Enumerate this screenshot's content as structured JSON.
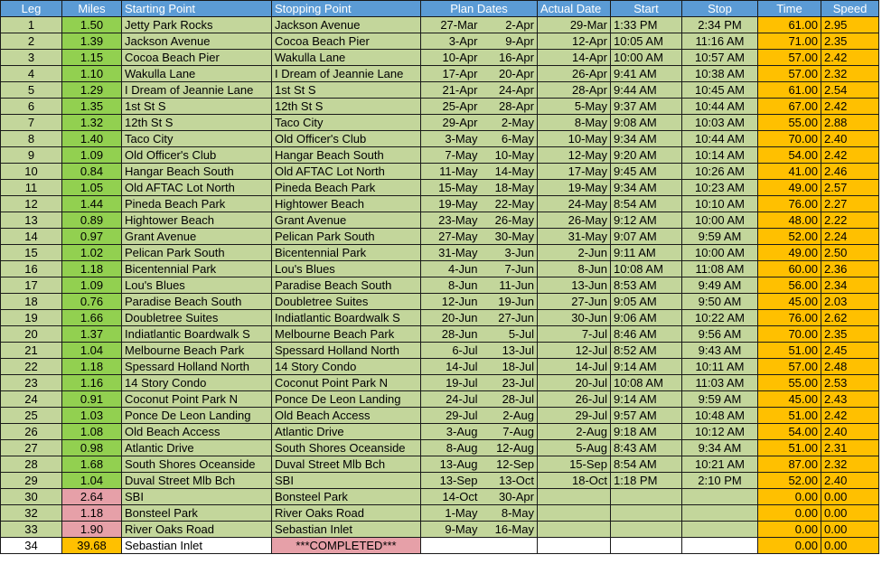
{
  "headers": {
    "leg": "Leg",
    "miles": "Miles",
    "start_point": "Starting Point",
    "stop_point": "Stopping Point",
    "plan_dates": "Plan Dates",
    "actual_date": "Actual Date",
    "start": "Start",
    "stop": "Stop",
    "time": "Time",
    "speed": "Speed"
  },
  "colors": {
    "header": "#5b9bd5",
    "row": "#c3d69b",
    "miles_done": "#92d050",
    "miles_pending": "#e6a0a8",
    "highlight": "#ffc000",
    "completed_banner": "#e6a0a8"
  },
  "rows": [
    {
      "leg": "1",
      "miles": "1.50",
      "from": "Jetty Park Rocks",
      "to": "Jackson Avenue",
      "plan_start": "27-Mar",
      "plan_end": "2-Apr",
      "actual": "29-Mar",
      "start": "1:33 PM",
      "stop": "2:34 PM",
      "time": "61.00",
      "speed": "2.95",
      "status": "done"
    },
    {
      "leg": "2",
      "miles": "1.39",
      "from": "Jackson Avenue",
      "to": "Cocoa Beach Pier",
      "plan_start": "3-Apr",
      "plan_end": "9-Apr",
      "actual": "12-Apr",
      "start": "10:05 AM",
      "stop": "11:16 AM",
      "time": "71.00",
      "speed": "2.35",
      "status": "done"
    },
    {
      "leg": "3",
      "miles": "1.15",
      "from": "Cocoa Beach Pier",
      "to": "Wakulla Lane",
      "plan_start": "10-Apr",
      "plan_end": "16-Apr",
      "actual": "14-Apr",
      "start": "10:00 AM",
      "stop": "10:57 AM",
      "time": "57.00",
      "speed": "2.42",
      "status": "done"
    },
    {
      "leg": "4",
      "miles": "1.10",
      "from": "Wakulla Lane",
      "to": "I Dream of Jeannie Lane",
      "plan_start": "17-Apr",
      "plan_end": "20-Apr",
      "actual": "26-Apr",
      "start": "9:41 AM",
      "stop": "10:38 AM",
      "time": "57.00",
      "speed": "2.32",
      "status": "done"
    },
    {
      "leg": "5",
      "miles": "1.29",
      "from": "I Dream of Jeannie Lane",
      "to": "1st St S",
      "plan_start": "21-Apr",
      "plan_end": "24-Apr",
      "actual": "28-Apr",
      "start": "9:44 AM",
      "stop": "10:45 AM",
      "time": "61.00",
      "speed": "2.54",
      "status": "done"
    },
    {
      "leg": "6",
      "miles": "1.35",
      "from": "1st St S",
      "to": "12th St S",
      "plan_start": "25-Apr",
      "plan_end": "28-Apr",
      "actual": "5-May",
      "start": "9:37 AM",
      "stop": "10:44 AM",
      "time": "67.00",
      "speed": "2.42",
      "status": "done"
    },
    {
      "leg": "7",
      "miles": "1.32",
      "from": "12th St S",
      "to": "Taco City",
      "plan_start": "29-Apr",
      "plan_end": "2-May",
      "actual": "8-May",
      "start": "9:08 AM",
      "stop": "10:03 AM",
      "time": "55.00",
      "speed": "2.88",
      "status": "done"
    },
    {
      "leg": "8",
      "miles": "1.40",
      "from": "Taco City",
      "to": "Old Officer's Club",
      "plan_start": "3-May",
      "plan_end": "6-May",
      "actual": "10-May",
      "start": "9:34 AM",
      "stop": "10:44 AM",
      "time": "70.00",
      "speed": "2.40",
      "status": "done"
    },
    {
      "leg": "9",
      "miles": "1.09",
      "from": "Old Officer's Club",
      "to": "Hangar Beach South",
      "plan_start": "7-May",
      "plan_end": "10-May",
      "actual": "12-May",
      "start": "9:20 AM",
      "stop": "10:14 AM",
      "time": "54.00",
      "speed": "2.42",
      "status": "done"
    },
    {
      "leg": "10",
      "miles": "0.84",
      "from": "Hangar Beach South",
      "to": "Old AFTAC Lot North",
      "plan_start": "11-May",
      "plan_end": "14-May",
      "actual": "17-May",
      "start": "9:45 AM",
      "stop": "10:26 AM",
      "time": "41.00",
      "speed": "2.46",
      "status": "done"
    },
    {
      "leg": "11",
      "miles": "1.05",
      "from": "Old AFTAC Lot North",
      "to": "Pineda Beach Park",
      "plan_start": "15-May",
      "plan_end": "18-May",
      "actual": "19-May",
      "start": "9:34 AM",
      "stop": "10:23 AM",
      "time": "49.00",
      "speed": "2.57",
      "status": "done"
    },
    {
      "leg": "12",
      "miles": "1.44",
      "from": "Pineda Beach Park",
      "to": "Hightower Beach",
      "plan_start": "19-May",
      "plan_end": "22-May",
      "actual": "24-May",
      "start": "8:54 AM",
      "stop": "10:10 AM",
      "time": "76.00",
      "speed": "2.27",
      "status": "done"
    },
    {
      "leg": "13",
      "miles": "0.89",
      "from": "Hightower Beach",
      "to": "Grant Avenue",
      "plan_start": "23-May",
      "plan_end": "26-May",
      "actual": "26-May",
      "start": "9:12 AM",
      "stop": "10:00 AM",
      "time": "48.00",
      "speed": "2.22",
      "status": "done"
    },
    {
      "leg": "14",
      "miles": "0.97",
      "from": "Grant Avenue",
      "to": "Pelican Park South",
      "plan_start": "27-May",
      "plan_end": "30-May",
      "actual": "31-May",
      "start": "9:07 AM",
      "stop": "9:59 AM",
      "time": "52.00",
      "speed": "2.24",
      "status": "done"
    },
    {
      "leg": "15",
      "miles": "1.02",
      "from": "Pelican Park South",
      "to": "Bicentennial Park",
      "plan_start": "31-May",
      "plan_end": "3-Jun",
      "actual": "2-Jun",
      "start": "9:11 AM",
      "stop": "10:00 AM",
      "time": "49.00",
      "speed": "2.50",
      "status": "done"
    },
    {
      "leg": "16",
      "miles": "1.18",
      "from": "Bicentennial Park",
      "to": "Lou's Blues",
      "plan_start": "4-Jun",
      "plan_end": "7-Jun",
      "actual": "8-Jun",
      "start": "10:08 AM",
      "stop": "11:08 AM",
      "time": "60.00",
      "speed": "2.36",
      "status": "done"
    },
    {
      "leg": "17",
      "miles": "1.09",
      "from": "Lou's Blues",
      "to": "Paradise Beach South",
      "plan_start": "8-Jun",
      "plan_end": "11-Jun",
      "actual": "13-Jun",
      "start": "8:53 AM",
      "stop": "9:49 AM",
      "time": "56.00",
      "speed": "2.34",
      "status": "done"
    },
    {
      "leg": "18",
      "miles": "0.76",
      "from": "Paradise Beach South",
      "to": "Doubletree Suites",
      "plan_start": "12-Jun",
      "plan_end": "19-Jun",
      "actual": "27-Jun",
      "start": "9:05 AM",
      "stop": "9:50 AM",
      "time": "45.00",
      "speed": "2.03",
      "status": "done"
    },
    {
      "leg": "19",
      "miles": "1.66",
      "from": "Doubletree Suites",
      "to": "Indiatlantic Boardwalk S",
      "plan_start": "20-Jun",
      "plan_end": "27-Jun",
      "actual": "30-Jun",
      "start": "9:06 AM",
      "stop": "10:22 AM",
      "time": "76.00",
      "speed": "2.62",
      "status": "done"
    },
    {
      "leg": "20",
      "miles": "1.37",
      "from": "Indiatlantic Boardwalk S",
      "to": "Melbourne Beach Park",
      "plan_start": "28-Jun",
      "plan_end": "5-Jul",
      "actual": "7-Jul",
      "start": "8:46 AM",
      "stop": "9:56 AM",
      "time": "70.00",
      "speed": "2.35",
      "status": "done"
    },
    {
      "leg": "21",
      "miles": "1.04",
      "from": "Melbourne Beach Park",
      "to": "Spessard Holland North",
      "plan_start": "6-Jul",
      "plan_end": "13-Jul",
      "actual": "12-Jul",
      "start": "8:52 AM",
      "stop": "9:43 AM",
      "time": "51.00",
      "speed": "2.45",
      "status": "done"
    },
    {
      "leg": "22",
      "miles": "1.18",
      "from": "Spessard Holland North",
      "to": "14 Story Condo",
      "plan_start": "14-Jul",
      "plan_end": "18-Jul",
      "actual": "14-Jul",
      "start": "9:14 AM",
      "stop": "10:11 AM",
      "time": "57.00",
      "speed": "2.48",
      "status": "done"
    },
    {
      "leg": "23",
      "miles": "1.16",
      "from": "14 Story Condo",
      "to": "Coconut Point Park N",
      "plan_start": "19-Jul",
      "plan_end": "23-Jul",
      "actual": "20-Jul",
      "start": "10:08 AM",
      "stop": "11:03 AM",
      "time": "55.00",
      "speed": "2.53",
      "status": "done"
    },
    {
      "leg": "24",
      "miles": "0.91",
      "from": "Coconut Point Park N",
      "to": "Ponce De Leon Landing",
      "plan_start": "24-Jul",
      "plan_end": "28-Jul",
      "actual": "26-Jul",
      "start": "9:14 AM",
      "stop": "9:59 AM",
      "time": "45.00",
      "speed": "2.43",
      "status": "done"
    },
    {
      "leg": "25",
      "miles": "1.03",
      "from": "Ponce De Leon Landing",
      "to": "Old Beach Access",
      "plan_start": "29-Jul",
      "plan_end": "2-Aug",
      "actual": "29-Jul",
      "start": "9:57 AM",
      "stop": "10:48 AM",
      "time": "51.00",
      "speed": "2.42",
      "status": "done"
    },
    {
      "leg": "26",
      "miles": "1.08",
      "from": "Old Beach Access",
      "to": "Atlantic Drive",
      "plan_start": "3-Aug",
      "plan_end": "7-Aug",
      "actual": "2-Aug",
      "start": "9:18 AM",
      "stop": "10:12 AM",
      "time": "54.00",
      "speed": "2.40",
      "status": "done"
    },
    {
      "leg": "27",
      "miles": "0.98",
      "from": "Atlantic Drive",
      "to": "South Shores Oceanside",
      "plan_start": "8-Aug",
      "plan_end": "12-Aug",
      "actual": "5-Aug",
      "start": "8:43 AM",
      "stop": "9:34 AM",
      "time": "51.00",
      "speed": "2.31",
      "status": "done"
    },
    {
      "leg": "28",
      "miles": "1.68",
      "from": "South Shores Oceanside",
      "to": "Duval Street Mlb Bch",
      "plan_start": "13-Aug",
      "plan_end": "12-Sep",
      "actual": "15-Sep",
      "start": "8:54 AM",
      "stop": "10:21 AM",
      "time": "87.00",
      "speed": "2.32",
      "status": "done"
    },
    {
      "leg": "29",
      "miles": "1.04",
      "from": "Duval Street Mlb Bch",
      "to": "SBI",
      "plan_start": "13-Sep",
      "plan_end": "13-Oct",
      "actual": "18-Oct",
      "start": "1:18 PM",
      "stop": "2:10 PM",
      "time": "52.00",
      "speed": "2.40",
      "status": "done"
    },
    {
      "leg": "30",
      "miles": "2.64",
      "from": "SBI",
      "to": "Bonsteel Park",
      "plan_start": "14-Oct",
      "plan_end": "30-Apr",
      "actual": "",
      "start": "",
      "stop": "",
      "time": "0.00",
      "speed": "0.00",
      "status": "pending"
    },
    {
      "leg": "32",
      "miles": "1.18",
      "from": "Bonsteel Park",
      "to": "River Oaks Road",
      "plan_start": "1-May",
      "plan_end": "8-May",
      "actual": "",
      "start": "",
      "stop": "",
      "time": "0.00",
      "speed": "0.00",
      "status": "pending"
    },
    {
      "leg": "33",
      "miles": "1.90",
      "from": "River Oaks Road",
      "to": "Sebastian Inlet",
      "plan_start": "9-May",
      "plan_end": "16-May",
      "actual": "",
      "start": "",
      "stop": "",
      "time": "0.00",
      "speed": "0.00",
      "status": "pending"
    },
    {
      "leg": "34",
      "miles": "39.68",
      "from": "Sebastian Inlet",
      "to": "***COMPLETED***",
      "plan_start": "",
      "plan_end": "",
      "actual": "",
      "start": "",
      "stop": "",
      "time": "0.00",
      "speed": "0.00",
      "status": "total"
    }
  ]
}
